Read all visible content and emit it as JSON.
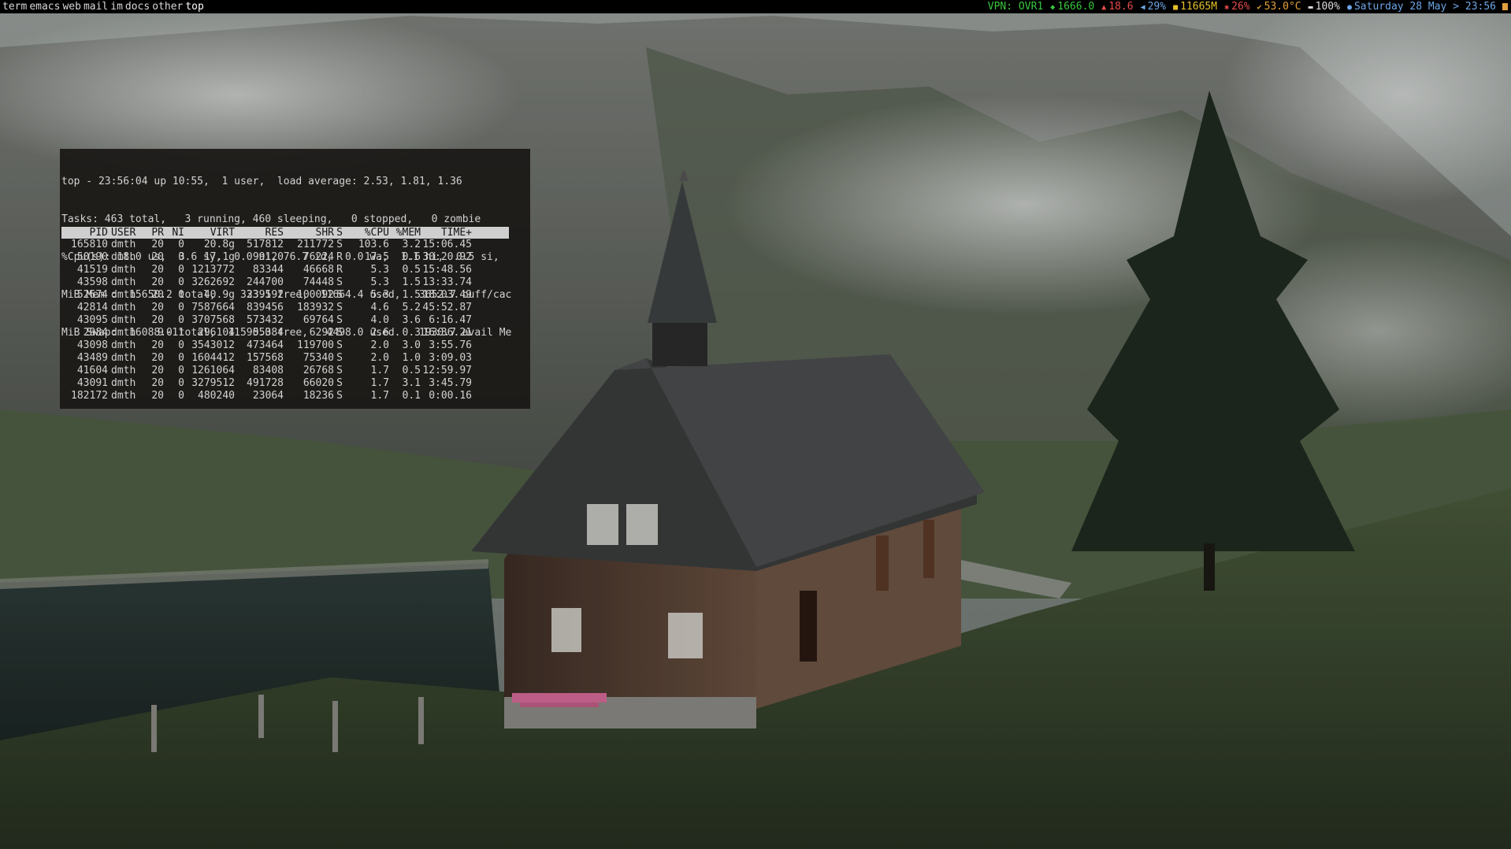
{
  "workspaces": [
    "term",
    "emacs",
    "web",
    "mail",
    "im",
    "docs",
    "other",
    "top"
  ],
  "status": [
    {
      "label": "VPN: OVR1",
      "color": "green"
    },
    {
      "label": "1666.0",
      "color": "green",
      "icon": "cpu-freq-icon",
      "glyph": "◆"
    },
    {
      "label": "18.6",
      "color": "red",
      "icon": "upload-icon",
      "glyph": "▲"
    },
    {
      "label": "29%",
      "color": "blue",
      "icon": "volume-icon",
      "glyph": "◀"
    },
    {
      "label": "11665M",
      "color": "yellow",
      "icon": "memory-icon",
      "glyph": "■"
    },
    {
      "label": "26%",
      "color": "red",
      "icon": "cpu-icon",
      "glyph": "✱"
    },
    {
      "label": "53.0°C",
      "color": "orange",
      "icon": "temperature-icon",
      "glyph": "✔"
    },
    {
      "label": "100%",
      "color": "white",
      "icon": "battery-icon",
      "glyph": "▬"
    },
    {
      "label": "Saturday 28 May > 23:56",
      "color": "blue",
      "icon": "clock-icon",
      "glyph": "●"
    }
  ],
  "colors": {
    "green": "#39c73f",
    "red": "#e64b4b",
    "blue": "#6da5e6",
    "yellow": "#e6c229",
    "orange": "#e3a33a",
    "white": "#dddddd"
  },
  "top": {
    "summary": [
      "top - 23:56:04 up 10:55,  1 user,  load average: 2.53, 1.81, 1.36",
      "Tasks: 463 total,   3 running, 460 sleeping,   0 stopped,   0 zombie",
      "%Cpu(s): 18.0 us,  3.6 sy,  0.0 ni, 76.7 id,  0.0 wa,  1.1 hi,  0.5 si,",
      "MiB Mem :  15650.2 total,    333.1 free,  11664.4 used,   3652.7 buff/cac",
      "MiB Swap:  16088.0 total,  11590.0 free,   4498.0 used.   1930.7 avail Me"
    ],
    "columns": [
      "PID",
      "USER",
      "PR",
      "NI",
      "VIRT",
      "RES",
      "SHR",
      "S",
      "%CPU",
      "%MEM",
      "TIME+"
    ],
    "processes": [
      [
        "165810",
        "dmth",
        "20",
        "0",
        "20.8g",
        "517812",
        "211772",
        "S",
        "103.6",
        "3.2",
        "15:06.45"
      ],
      [
        "50190",
        "dmth",
        "20",
        "0",
        "17.1g",
        "99120",
        "76224",
        "R",
        "17.5",
        "0.6",
        "30:20.92"
      ],
      [
        "41519",
        "dmth",
        "20",
        "0",
        "1213772",
        "83344",
        "46668",
        "R",
        "5.3",
        "0.5",
        "15:48.56"
      ],
      [
        "43598",
        "dmth",
        "20",
        "0",
        "3262692",
        "244700",
        "74448",
        "S",
        "5.3",
        "1.5",
        "13:33.74"
      ],
      [
        "52674",
        "dmth",
        "20",
        "0",
        "40.9g",
        "239592",
        "100092",
        "S",
        "5.3",
        "1.5",
        "18:03.49"
      ],
      [
        "42814",
        "dmth",
        "20",
        "0",
        "7587664",
        "839456",
        "183932",
        "S",
        "4.6",
        "5.2",
        "45:52.87"
      ],
      [
        "43095",
        "dmth",
        "20",
        "0",
        "3707568",
        "573432",
        "69764",
        "S",
        "4.0",
        "3.6",
        "6:16.47"
      ],
      [
        "2984",
        "dmth",
        "9",
        "-11",
        "296104",
        "55384",
        "6292",
        "S",
        "2.6",
        "0.3",
        "16:36.21"
      ],
      [
        "43098",
        "dmth",
        "20",
        "0",
        "3543012",
        "473464",
        "119700",
        "S",
        "2.0",
        "3.0",
        "3:55.76"
      ],
      [
        "43489",
        "dmth",
        "20",
        "0",
        "1604412",
        "157568",
        "75340",
        "S",
        "2.0",
        "1.0",
        "3:09.03"
      ],
      [
        "41604",
        "dmth",
        "20",
        "0",
        "1261064",
        "83408",
        "26768",
        "S",
        "1.7",
        "0.5",
        "12:59.97"
      ],
      [
        "43091",
        "dmth",
        "20",
        "0",
        "3279512",
        "491728",
        "66020",
        "S",
        "1.7",
        "3.1",
        "3:45.79"
      ],
      [
        "182172",
        "dmth",
        "20",
        "0",
        "480240",
        "23064",
        "18236",
        "S",
        "1.7",
        "0.1",
        "0:00.16"
      ]
    ]
  }
}
